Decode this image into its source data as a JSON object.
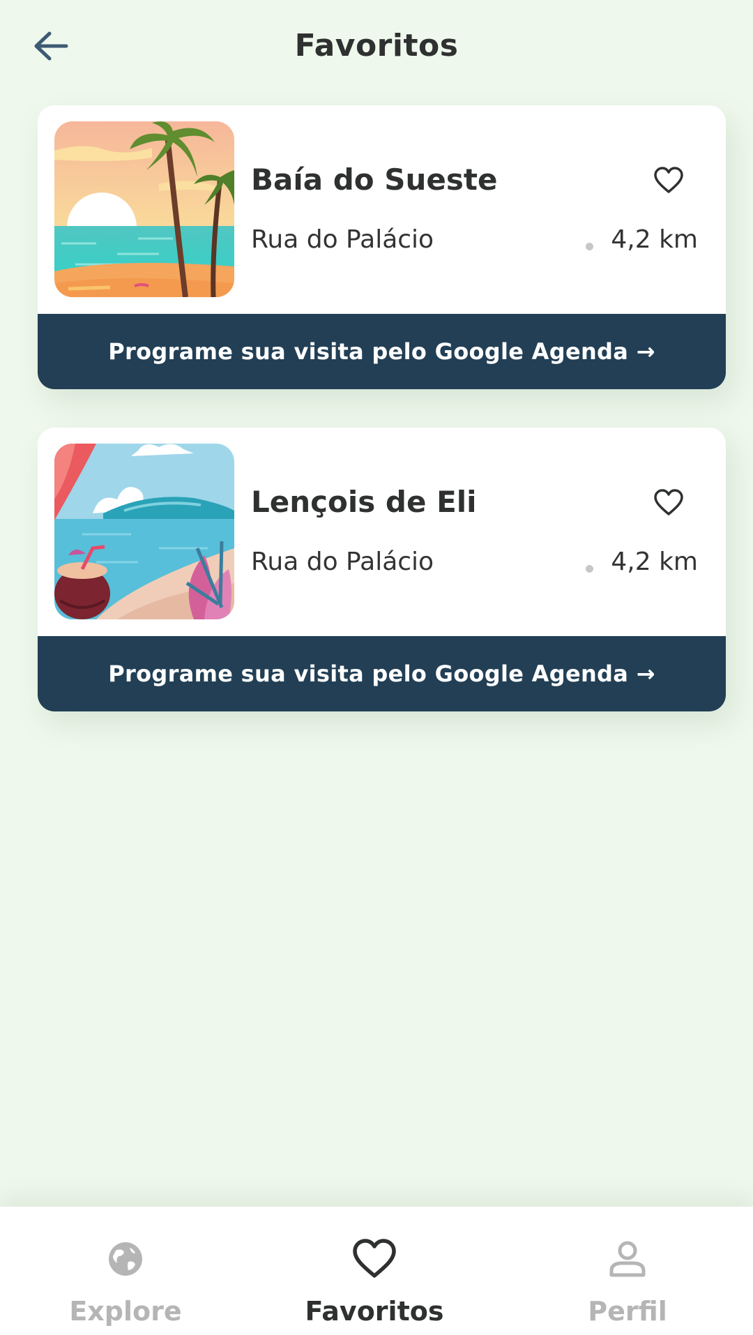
{
  "header": {
    "title": "Favoritos",
    "back_icon": "arrow-left-icon"
  },
  "favorites": [
    {
      "name": "Baía do Sueste",
      "address": "Rua do Palácio",
      "distance": "4,2 km",
      "favorite_icon": "heart-outline-icon",
      "cta_label": "Programe sua visita pelo Google Agenda →"
    },
    {
      "name": "Lençois de Eli",
      "address": "Rua do Palácio",
      "distance": "4,2 km",
      "favorite_icon": "heart-outline-icon",
      "cta_label": "Programe sua visita pelo Google Agenda →"
    }
  ],
  "bottom_nav": {
    "items": [
      {
        "label": "Explore",
        "icon": "globe-icon",
        "active": false
      },
      {
        "label": "Favoritos",
        "icon": "heart-icon",
        "active": true
      },
      {
        "label": "Perfil",
        "icon": "person-icon",
        "active": false
      }
    ]
  },
  "colors": {
    "background": "#eef8ec",
    "card": "#ffffff",
    "cta_bar": "#223f55",
    "text_dark": "#2f3030",
    "nav_inactive": "#b5b5b5",
    "back_arrow": "#3d5a73"
  }
}
